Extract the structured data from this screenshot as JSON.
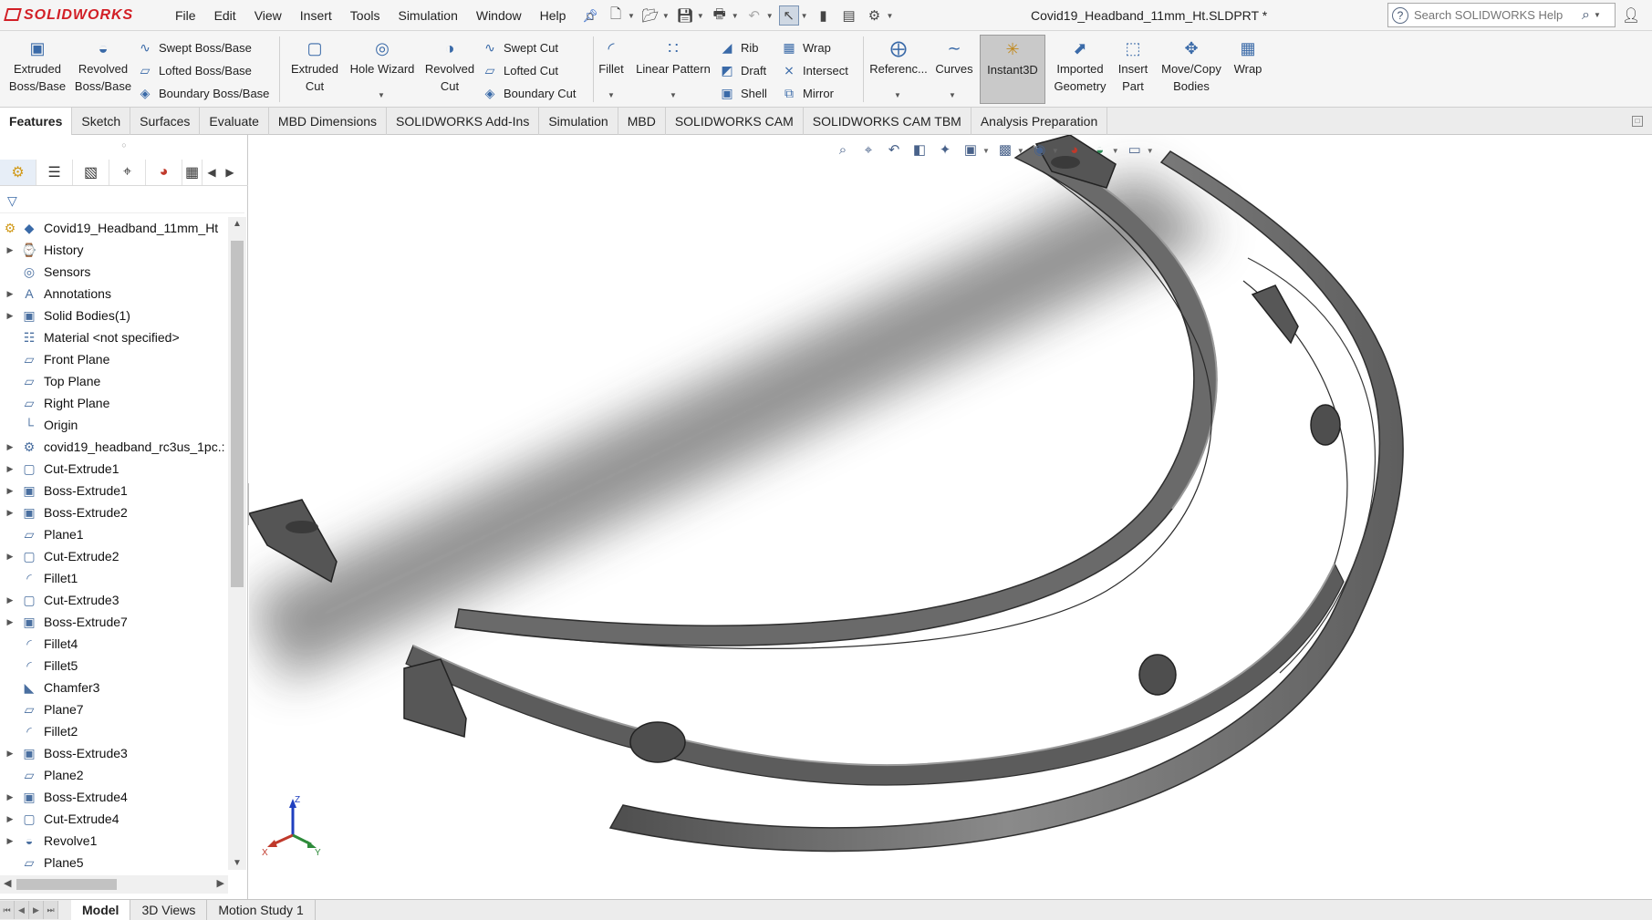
{
  "app": {
    "logo_text": "SOLIDWORKS",
    "document_title": "Covid19_Headband_11mm_Ht.SLDPRT *"
  },
  "menu": {
    "items": [
      "File",
      "Edit",
      "View",
      "Insert",
      "Tools",
      "Simulation",
      "Window",
      "Help"
    ]
  },
  "search": {
    "placeholder": "Search SOLIDWORKS Help"
  },
  "ribbon": {
    "extruded_boss": "Extruded Boss/Base",
    "revolved_boss": "Revolved Boss/Base",
    "swept_boss": "Swept Boss/Base",
    "lofted_boss": "Lofted Boss/Base",
    "boundary_boss": "Boundary Boss/Base",
    "extruded_cut": "Extruded Cut",
    "hole_wizard": "Hole Wizard",
    "revolved_cut": "Revolved Cut",
    "swept_cut": "Swept Cut",
    "lofted_cut": "Lofted Cut",
    "boundary_cut": "Boundary Cut",
    "fillet": "Fillet",
    "linear_pattern": "Linear Pattern",
    "rib": "Rib",
    "draft": "Draft",
    "shell": "Shell",
    "wrap": "Wrap",
    "intersect": "Intersect",
    "mirror": "Mirror",
    "reference": "Referenc...",
    "curves": "Curves",
    "instant3d": "Instant3D",
    "imported_geometry": "Imported Geometry",
    "insert_part": "Insert Part",
    "move_copy_bodies": "Move/Copy Bodies",
    "wrap2": "Wrap"
  },
  "command_tabs": [
    "Features",
    "Sketch",
    "Surfaces",
    "Evaluate",
    "MBD Dimensions",
    "SOLIDWORKS Add-Ins",
    "Simulation",
    "MBD",
    "SOLIDWORKS CAM",
    "SOLIDWORKS CAM TBM",
    "Analysis Preparation"
  ],
  "feature_tree": {
    "root": "Covid19_Headband_11mm_Ht",
    "items": [
      {
        "label": "History",
        "icon": "history-icon",
        "expandable": true
      },
      {
        "label": "Sensors",
        "icon": "sensors-icon",
        "expandable": false
      },
      {
        "label": "Annotations",
        "icon": "annotations-icon",
        "expandable": true
      },
      {
        "label": "Solid Bodies(1)",
        "icon": "solid-bodies-icon",
        "expandable": true
      },
      {
        "label": "Material <not specified>",
        "icon": "material-icon",
        "expandable": false
      },
      {
        "label": "Front Plane",
        "icon": "plane-icon",
        "expandable": false
      },
      {
        "label": "Top Plane",
        "icon": "plane-icon",
        "expandable": false
      },
      {
        "label": "Right Plane",
        "icon": "plane-icon",
        "expandable": false
      },
      {
        "label": "Origin",
        "icon": "origin-icon",
        "expandable": false
      },
      {
        "label": "covid19_headband_rc3us_1pc.:",
        "icon": "imported-part-icon",
        "expandable": true
      },
      {
        "label": "Cut-Extrude1",
        "icon": "cut-extrude-icon",
        "expandable": true
      },
      {
        "label": "Boss-Extrude1",
        "icon": "boss-extrude-icon",
        "expandable": true
      },
      {
        "label": "Boss-Extrude2",
        "icon": "boss-extrude-icon",
        "expandable": true
      },
      {
        "label": "Plane1",
        "icon": "plane-icon",
        "expandable": false
      },
      {
        "label": "Cut-Extrude2",
        "icon": "cut-extrude-icon",
        "expandable": true
      },
      {
        "label": "Fillet1",
        "icon": "fillet-icon",
        "expandable": false
      },
      {
        "label": "Cut-Extrude3",
        "icon": "cut-extrude-icon",
        "expandable": true
      },
      {
        "label": "Boss-Extrude7",
        "icon": "boss-extrude-icon",
        "expandable": true
      },
      {
        "label": "Fillet4",
        "icon": "fillet-icon",
        "expandable": false
      },
      {
        "label": "Fillet5",
        "icon": "fillet-icon",
        "expandable": false
      },
      {
        "label": "Chamfer3",
        "icon": "chamfer-icon",
        "expandable": false
      },
      {
        "label": "Plane7",
        "icon": "plane-icon",
        "expandable": false
      },
      {
        "label": "Fillet2",
        "icon": "fillet-icon",
        "expandable": false
      },
      {
        "label": "Boss-Extrude3",
        "icon": "boss-extrude-icon",
        "expandable": true
      },
      {
        "label": "Plane2",
        "icon": "plane-icon",
        "expandable": false
      },
      {
        "label": "Boss-Extrude4",
        "icon": "boss-extrude-icon",
        "expandable": true
      },
      {
        "label": "Cut-Extrude4",
        "icon": "cut-extrude-icon",
        "expandable": true
      },
      {
        "label": "Revolve1",
        "icon": "revolve-icon",
        "expandable": true
      },
      {
        "label": "Plane5",
        "icon": "plane-icon",
        "expandable": false
      }
    ]
  },
  "triad": {
    "z": "Z",
    "x": "X",
    "y": "Y"
  },
  "bottom_tabs": [
    "Model",
    "3D Views",
    "Motion Study 1"
  ],
  "colors": {
    "brand_red": "#d21f26",
    "model_gray": "#6e6e6e",
    "tree_icon_blue": "#4a6fa0"
  }
}
